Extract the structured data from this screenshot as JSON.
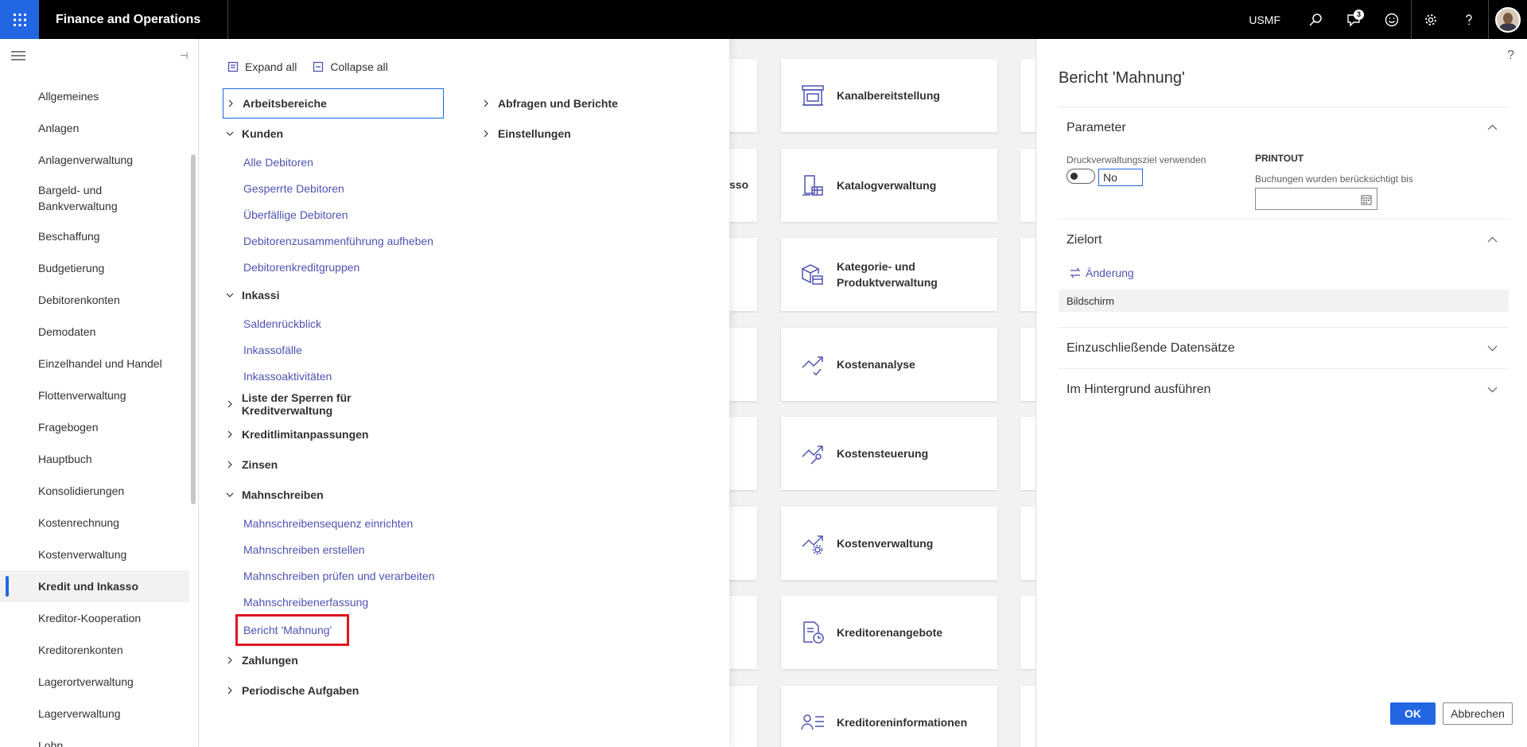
{
  "topbar": {
    "app_title": "Finance and Operations",
    "company": "USMF",
    "notification_count": "3"
  },
  "leftnav": {
    "items": [
      {
        "label": "Allgemeines"
      },
      {
        "label": "Anlagen"
      },
      {
        "label": "Anlagenverwaltung"
      },
      {
        "label": "Bargeld- und Bankverwaltung"
      },
      {
        "label": "Beschaffung"
      },
      {
        "label": "Budgetierung"
      },
      {
        "label": "Debitorenkonten"
      },
      {
        "label": "Demodaten"
      },
      {
        "label": "Einzelhandel und Handel"
      },
      {
        "label": "Flottenverwaltung"
      },
      {
        "label": "Fragebogen"
      },
      {
        "label": "Hauptbuch"
      },
      {
        "label": "Konsolidierungen"
      },
      {
        "label": "Kostenrechnung"
      },
      {
        "label": "Kostenverwaltung"
      },
      {
        "label": "Kredit und Inkasso",
        "selected": true
      },
      {
        "label": "Kreditor-Kooperation"
      },
      {
        "label": "Kreditorenkonten"
      },
      {
        "label": "Lagerortverwaltung"
      },
      {
        "label": "Lagerverwaltung"
      },
      {
        "label": "Lohn"
      }
    ]
  },
  "menu": {
    "expand_all": "Expand all",
    "collapse_all": "Collapse all",
    "col1": {
      "arbeitsbereiche": "Arbeitsbereiche",
      "kunden": "Kunden",
      "kunden_links": [
        "Alle Debitoren",
        "Gesperrte Debitoren",
        "Überfällige Debitoren",
        "Debitorenzusammenführung aufheben",
        "Debitorenkreditgruppen"
      ],
      "inkassi": "Inkassi",
      "inkassi_links": [
        "Saldenrückblick",
        "Inkassofälle",
        "Inkassoaktivitäten"
      ],
      "sperren": "Liste der Sperren für Kreditverwaltung",
      "kreditlimit": "Kreditlimitanpassungen",
      "zinsen": "Zinsen",
      "mahnschreiben": "Mahnschreiben",
      "mahnschreiben_links": [
        "Mahnschreibensequenz einrichten",
        "Mahnschreiben erstellen",
        "Mahnschreiben prüfen und verarbeiten",
        "Mahnschreibenerfassung",
        "Bericht 'Mahnung'"
      ],
      "zahlungen": "Zahlungen",
      "periodisch": "Periodische Aufgaben"
    },
    "col2": {
      "abfragen": "Abfragen und Berichte",
      "einstellungen": "Einstellungen"
    }
  },
  "tiles": {
    "partial_text": "sso",
    "items": [
      {
        "label": "Kanalbereitstellung",
        "icon": "store-icon"
      },
      {
        "label": "Katalogverwaltung",
        "icon": "catalog-icon"
      },
      {
        "label": "Kategorie- und Produktverwaltung",
        "icon": "boxes-icon"
      },
      {
        "label": "Kostenanalyse",
        "icon": "chart-check-icon"
      },
      {
        "label": "Kostensteuerung",
        "icon": "chart-wrench-icon"
      },
      {
        "label": "Kostenverwaltung",
        "icon": "chart-gear-icon"
      },
      {
        "label": "Kreditorenangebote",
        "icon": "document-clock-icon"
      },
      {
        "label": "Kreditoreninformationen",
        "icon": "person-list-icon"
      }
    ]
  },
  "dialog": {
    "title": "Bericht 'Mahnung'",
    "parameter": {
      "header": "Parameter",
      "print_dest_label": "Druckverwaltungsziel verwenden",
      "print_dest_value": "No",
      "printout_label": "PRINTOUT",
      "posted_until_label": "Buchungen wurden berücksichtigt bis",
      "posted_until_value": ""
    },
    "zielort": {
      "header": "Zielort",
      "change_label": "Änderung",
      "destination": "Bildschirm"
    },
    "records": {
      "header": "Einzuschließende Datensätze"
    },
    "background": {
      "header": "Im Hintergrund ausführen"
    },
    "ok": "OK",
    "cancel": "Abbrechen"
  }
}
